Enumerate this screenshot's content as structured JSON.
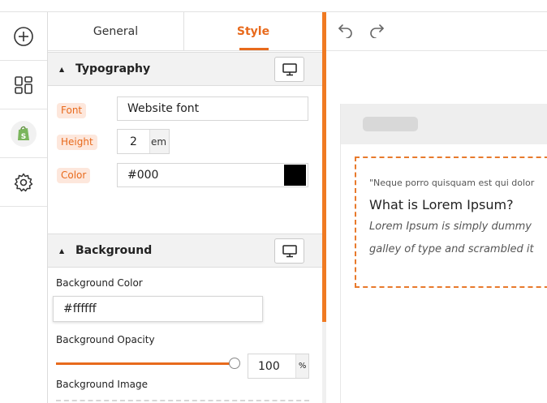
{
  "tabs": {
    "general": "General",
    "style": "Style"
  },
  "typography": {
    "title": "Typography",
    "font_label": "Font",
    "font_value": "Website font",
    "height_label": "Height",
    "height_value": "2",
    "height_unit": "em",
    "color_label": "Color",
    "color_value": "#000",
    "swatch_color": "#000000"
  },
  "background": {
    "title": "Background",
    "color_label": "Background Color",
    "color_value": "#ffffff",
    "opacity_label": "Background Opacity",
    "opacity_value": "100",
    "opacity_unit": "%",
    "opacity_fraction": 1.0,
    "image_label": "Background Image"
  },
  "preview": {
    "quote": "\"Neque porro quisquam est qui dolor",
    "heading": "What is Lorem Ipsum?",
    "line1": "Lorem Ipsum is simply dummy",
    "line2": "galley of type and scrambled it"
  },
  "icons": {
    "rail": [
      "add-icon",
      "layout-icon",
      "shopify-icon",
      "settings-icon"
    ],
    "toolbar": [
      "undo-icon",
      "redo-icon"
    ],
    "device": "desktop-icon"
  },
  "colors": {
    "accent": "#e86a1c",
    "pill_bg": "#fde7dc"
  }
}
